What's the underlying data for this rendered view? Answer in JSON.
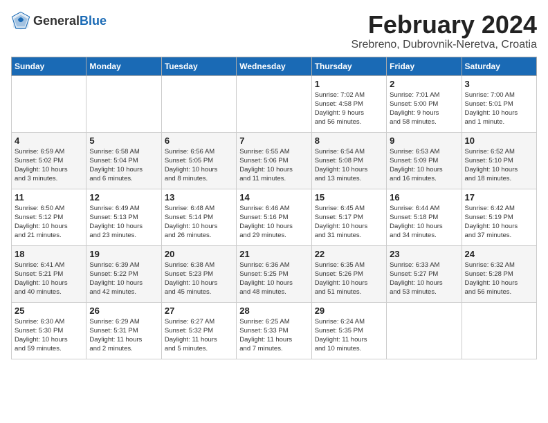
{
  "header": {
    "logo_general": "General",
    "logo_blue": "Blue",
    "month_title": "February 2024",
    "location": "Srebreno, Dubrovnik-Neretva, Croatia"
  },
  "weekdays": [
    "Sunday",
    "Monday",
    "Tuesday",
    "Wednesday",
    "Thursday",
    "Friday",
    "Saturday"
  ],
  "weeks": [
    [
      {
        "day": "",
        "info": ""
      },
      {
        "day": "",
        "info": ""
      },
      {
        "day": "",
        "info": ""
      },
      {
        "day": "",
        "info": ""
      },
      {
        "day": "1",
        "info": "Sunrise: 7:02 AM\nSunset: 4:58 PM\nDaylight: 9 hours\nand 56 minutes."
      },
      {
        "day": "2",
        "info": "Sunrise: 7:01 AM\nSunset: 5:00 PM\nDaylight: 9 hours\nand 58 minutes."
      },
      {
        "day": "3",
        "info": "Sunrise: 7:00 AM\nSunset: 5:01 PM\nDaylight: 10 hours\nand 1 minute."
      }
    ],
    [
      {
        "day": "4",
        "info": "Sunrise: 6:59 AM\nSunset: 5:02 PM\nDaylight: 10 hours\nand 3 minutes."
      },
      {
        "day": "5",
        "info": "Sunrise: 6:58 AM\nSunset: 5:04 PM\nDaylight: 10 hours\nand 6 minutes."
      },
      {
        "day": "6",
        "info": "Sunrise: 6:56 AM\nSunset: 5:05 PM\nDaylight: 10 hours\nand 8 minutes."
      },
      {
        "day": "7",
        "info": "Sunrise: 6:55 AM\nSunset: 5:06 PM\nDaylight: 10 hours\nand 11 minutes."
      },
      {
        "day": "8",
        "info": "Sunrise: 6:54 AM\nSunset: 5:08 PM\nDaylight: 10 hours\nand 13 minutes."
      },
      {
        "day": "9",
        "info": "Sunrise: 6:53 AM\nSunset: 5:09 PM\nDaylight: 10 hours\nand 16 minutes."
      },
      {
        "day": "10",
        "info": "Sunrise: 6:52 AM\nSunset: 5:10 PM\nDaylight: 10 hours\nand 18 minutes."
      }
    ],
    [
      {
        "day": "11",
        "info": "Sunrise: 6:50 AM\nSunset: 5:12 PM\nDaylight: 10 hours\nand 21 minutes."
      },
      {
        "day": "12",
        "info": "Sunrise: 6:49 AM\nSunset: 5:13 PM\nDaylight: 10 hours\nand 23 minutes."
      },
      {
        "day": "13",
        "info": "Sunrise: 6:48 AM\nSunset: 5:14 PM\nDaylight: 10 hours\nand 26 minutes."
      },
      {
        "day": "14",
        "info": "Sunrise: 6:46 AM\nSunset: 5:16 PM\nDaylight: 10 hours\nand 29 minutes."
      },
      {
        "day": "15",
        "info": "Sunrise: 6:45 AM\nSunset: 5:17 PM\nDaylight: 10 hours\nand 31 minutes."
      },
      {
        "day": "16",
        "info": "Sunrise: 6:44 AM\nSunset: 5:18 PM\nDaylight: 10 hours\nand 34 minutes."
      },
      {
        "day": "17",
        "info": "Sunrise: 6:42 AM\nSunset: 5:19 PM\nDaylight: 10 hours\nand 37 minutes."
      }
    ],
    [
      {
        "day": "18",
        "info": "Sunrise: 6:41 AM\nSunset: 5:21 PM\nDaylight: 10 hours\nand 40 minutes."
      },
      {
        "day": "19",
        "info": "Sunrise: 6:39 AM\nSunset: 5:22 PM\nDaylight: 10 hours\nand 42 minutes."
      },
      {
        "day": "20",
        "info": "Sunrise: 6:38 AM\nSunset: 5:23 PM\nDaylight: 10 hours\nand 45 minutes."
      },
      {
        "day": "21",
        "info": "Sunrise: 6:36 AM\nSunset: 5:25 PM\nDaylight: 10 hours\nand 48 minutes."
      },
      {
        "day": "22",
        "info": "Sunrise: 6:35 AM\nSunset: 5:26 PM\nDaylight: 10 hours\nand 51 minutes."
      },
      {
        "day": "23",
        "info": "Sunrise: 6:33 AM\nSunset: 5:27 PM\nDaylight: 10 hours\nand 53 minutes."
      },
      {
        "day": "24",
        "info": "Sunrise: 6:32 AM\nSunset: 5:28 PM\nDaylight: 10 hours\nand 56 minutes."
      }
    ],
    [
      {
        "day": "25",
        "info": "Sunrise: 6:30 AM\nSunset: 5:30 PM\nDaylight: 10 hours\nand 59 minutes."
      },
      {
        "day": "26",
        "info": "Sunrise: 6:29 AM\nSunset: 5:31 PM\nDaylight: 11 hours\nand 2 minutes."
      },
      {
        "day": "27",
        "info": "Sunrise: 6:27 AM\nSunset: 5:32 PM\nDaylight: 11 hours\nand 5 minutes."
      },
      {
        "day": "28",
        "info": "Sunrise: 6:25 AM\nSunset: 5:33 PM\nDaylight: 11 hours\nand 7 minutes."
      },
      {
        "day": "29",
        "info": "Sunrise: 6:24 AM\nSunset: 5:35 PM\nDaylight: 11 hours\nand 10 minutes."
      },
      {
        "day": "",
        "info": ""
      },
      {
        "day": "",
        "info": ""
      }
    ]
  ]
}
